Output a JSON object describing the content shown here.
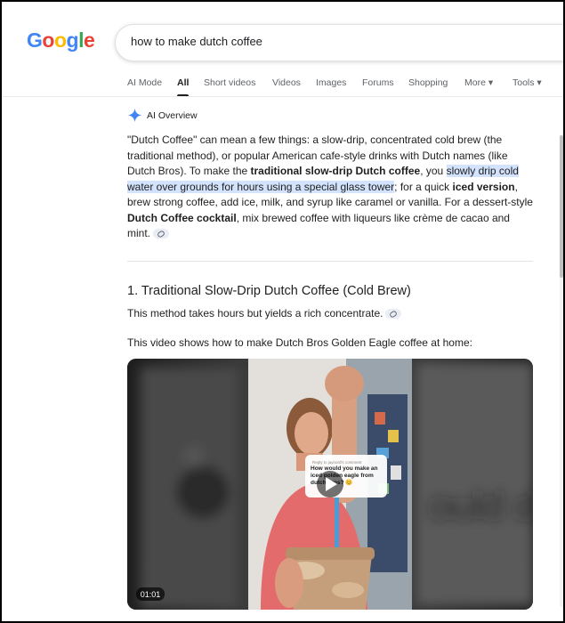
{
  "logo": {
    "letters": [
      "G",
      "o",
      "o",
      "g",
      "l",
      "e"
    ],
    "colors": [
      "#4285F4",
      "#EA4335",
      "#FBBC05",
      "#4285F4",
      "#34A853",
      "#EA4335"
    ]
  },
  "search": {
    "query": "how to make dutch coffee"
  },
  "tabs": [
    "AI Mode",
    "All",
    "Short videos",
    "Videos",
    "Images",
    "Forums",
    "Shopping",
    "More ▾",
    "Tools ▾"
  ],
  "active_tab": "All",
  "ai_overview": {
    "label": "AI Overview",
    "p_1": "\"Dutch Coffee\" can mean a few things: a slow-drip, concentrated cold brew (the traditional method), or popular American cafe-style drinks with Dutch names (like Dutch Bros). To make the ",
    "p_2": "traditional slow-drip Dutch coffee",
    "p_3": ", you ",
    "p_4": "slowly drip cold water over grounds for hours using a special glass tower",
    "p_5": "; for a quick ",
    "p_6": "iced version",
    "p_7": ", brew strong coffee, add ice, milk, and syrup like caramel or vanilla. For a dessert-style ",
    "p_8": "Dutch Coffee cocktail",
    "p_9": ", mix brewed coffee with liqueurs like crème de cacao and mint."
  },
  "section": {
    "title": "1. Traditional Slow-Drip Dutch Coffee (Cold Brew)",
    "desc": "This method takes hours but yields a rich concentrate.",
    "video_intro": "This video shows how to make Dutch Bros Golden Eagle coffee at home:"
  },
  "video": {
    "duration": "01:01",
    "reply_label": "Reply to jaynord's comment",
    "comment": "How would you make an iced golden eagle from dutch bros? 😊",
    "bg_text": "ould d eagle"
  },
  "colors": {
    "accent": "#1a73e8",
    "highlight": "#d3e3fd",
    "sparkle": "#4285F4"
  }
}
